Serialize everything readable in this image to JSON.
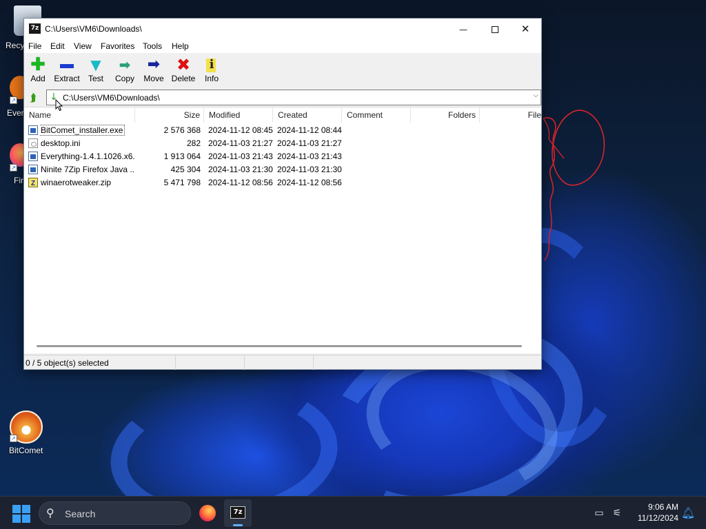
{
  "desktop": {
    "icons": [
      {
        "label": "Recy",
        "icon": "recycle-bin-icon"
      },
      {
        "label": "Ever",
        "icon": "everything-icon"
      },
      {
        "label": "Fir",
        "icon": "firefox-icon"
      },
      {
        "label": "BitComet",
        "icon": "bitcomet-icon"
      }
    ]
  },
  "window": {
    "title": "C:\\Users\\VM6\\Downloads\\",
    "app_icon_text": "7z",
    "controls": {
      "minimize": "—",
      "close": "✕"
    },
    "menu": [
      "File",
      "Edit",
      "View",
      "Favorites",
      "Tools",
      "Help"
    ],
    "toolbar": [
      {
        "label": "Add",
        "icon": "add-icon"
      },
      {
        "label": "Extract",
        "icon": "extract-icon"
      },
      {
        "label": "Test",
        "icon": "test-icon"
      },
      {
        "label": "Copy",
        "icon": "copy-icon"
      },
      {
        "label": "Move",
        "icon": "move-icon"
      },
      {
        "label": "Delete",
        "icon": "delete-icon"
      },
      {
        "label": "Info",
        "icon": "info-icon"
      }
    ],
    "address": "C:\\Users\\VM6\\Downloads\\",
    "columns": [
      "Name",
      "Size",
      "Modified",
      "Created",
      "Comment",
      "Folders",
      "File"
    ],
    "files": [
      {
        "name": "BitComet_installer.exe",
        "size": "2 576 368",
        "modified": "2024-11-12 08:45",
        "created": "2024-11-12 08:44",
        "type": "exe"
      },
      {
        "name": "desktop.ini",
        "size": "282",
        "modified": "2024-11-03 21:27",
        "created": "2024-11-03 21:27",
        "type": "ini"
      },
      {
        "name": "Everything-1.4.1.1026.x6...",
        "size": "1 913 064",
        "modified": "2024-11-03 21:43",
        "created": "2024-11-03 21:43",
        "type": "exe"
      },
      {
        "name": "Ninite 7Zip Firefox Java ...",
        "size": "425 304",
        "modified": "2024-11-03 21:30",
        "created": "2024-11-03 21:30",
        "type": "exe"
      },
      {
        "name": "winaerotweaker.zip",
        "size": "5 471 798",
        "modified": "2024-11-12 08:56",
        "created": "2024-11-12 08:56",
        "type": "zip"
      }
    ],
    "status": "0 / 5 object(s) selected"
  },
  "taskbar": {
    "search_placeholder": "Search",
    "time": "9:06 AM",
    "date": "11/12/2024",
    "seven_zip_label": "7z",
    "accent": "#5fb2ff"
  }
}
